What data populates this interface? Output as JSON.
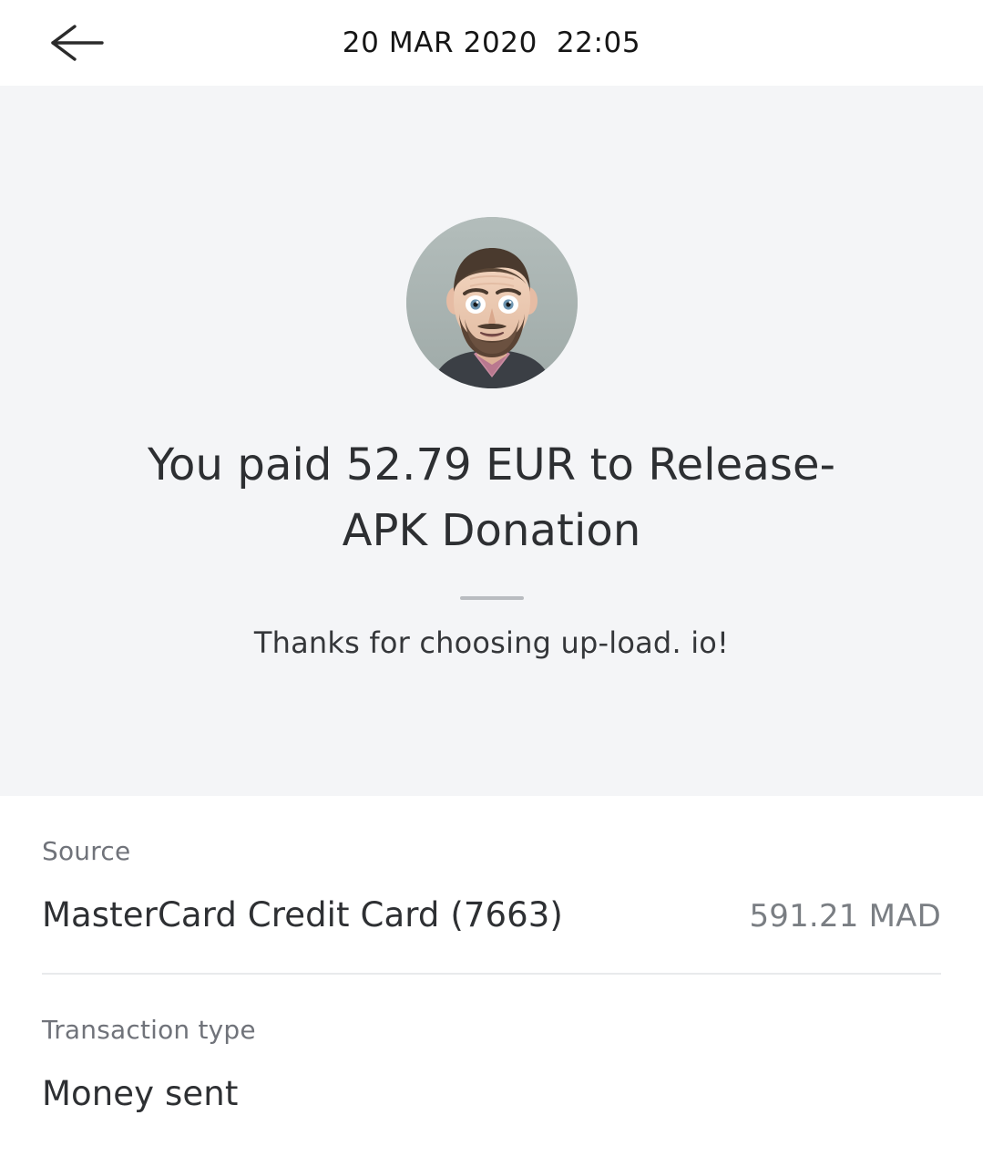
{
  "header": {
    "back_icon": "arrow-left-icon",
    "title": "20 MAR 2020  22:05"
  },
  "hero": {
    "avatar_alt": "recipient-avatar-photo",
    "title": "You paid 52.79 EUR to Release-APK Donation",
    "subtitle": "Thanks for choosing up-load. io!",
    "background_color": "#f4f5f7",
    "divider_color": "#b9bcc0"
  },
  "details": [
    {
      "label": "Source",
      "value": "MasterCard Credit Card (7663)",
      "amount": "591.21 MAD"
    },
    {
      "label": "Transaction type",
      "value": "Money sent",
      "amount": ""
    }
  ],
  "colors": {
    "text_primary": "#2e3033",
    "text_secondary": "#70737a",
    "text_amount": "#7a7e83",
    "divider": "#e8eaec",
    "page_background": "#ffffff"
  }
}
